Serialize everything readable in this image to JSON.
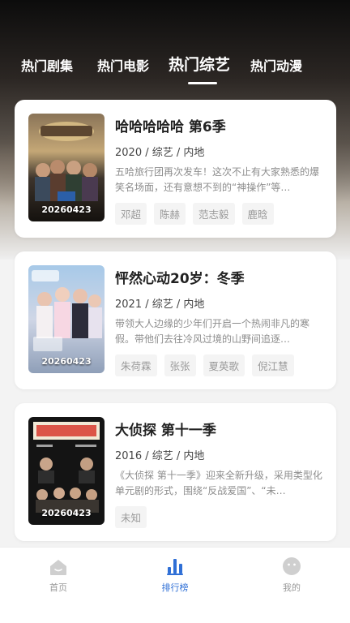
{
  "tabs": [
    {
      "label": "热门剧集",
      "active": false
    },
    {
      "label": "热门电影",
      "active": false
    },
    {
      "label": "热门综艺",
      "active": true
    },
    {
      "label": "热门动漫",
      "active": false
    }
  ],
  "items": [
    {
      "title": "哈哈哈哈哈 第6季",
      "meta": "2020 / 综艺 / 内地",
      "description": "五哈旅行团再次发车！这次不止有大家熟悉的爆笑名场面，还有意想不到的“神操作”等…",
      "poster_date": "20260423",
      "tags": [
        "邓超",
        "陈赫",
        "范志毅",
        "鹿晗"
      ]
    },
    {
      "title": "怦然心动20岁：冬季",
      "meta": "2021 / 综艺 / 内地",
      "description": "带领大人边缘的少年们开启一个热闹非凡的寒假。带他们去往冷风过境的山野间追逐…",
      "poster_date": "20260423",
      "tags": [
        "朱荷霖",
        "张张",
        "夏英歌",
        "倪江慧"
      ]
    },
    {
      "title": "大侦探 第十一季",
      "meta": "2016 / 综艺 / 内地",
      "description": "《大侦探 第十一季》迎来全新升级，采用类型化单元剧的形式，围绕“反战爱国”、“未…",
      "poster_date": "20260423",
      "tags": [
        "未知"
      ]
    }
  ],
  "bottom_nav": [
    {
      "label": "首页",
      "icon": "home-icon",
      "active": false
    },
    {
      "label": "排行榜",
      "icon": "ranking-icon",
      "active": true
    },
    {
      "label": "我的",
      "icon": "profile-icon",
      "active": false
    }
  ],
  "colors": {
    "accent": "#2f6fd6",
    "inactive": "#c8c8c8",
    "background": "#f3f3f3"
  }
}
